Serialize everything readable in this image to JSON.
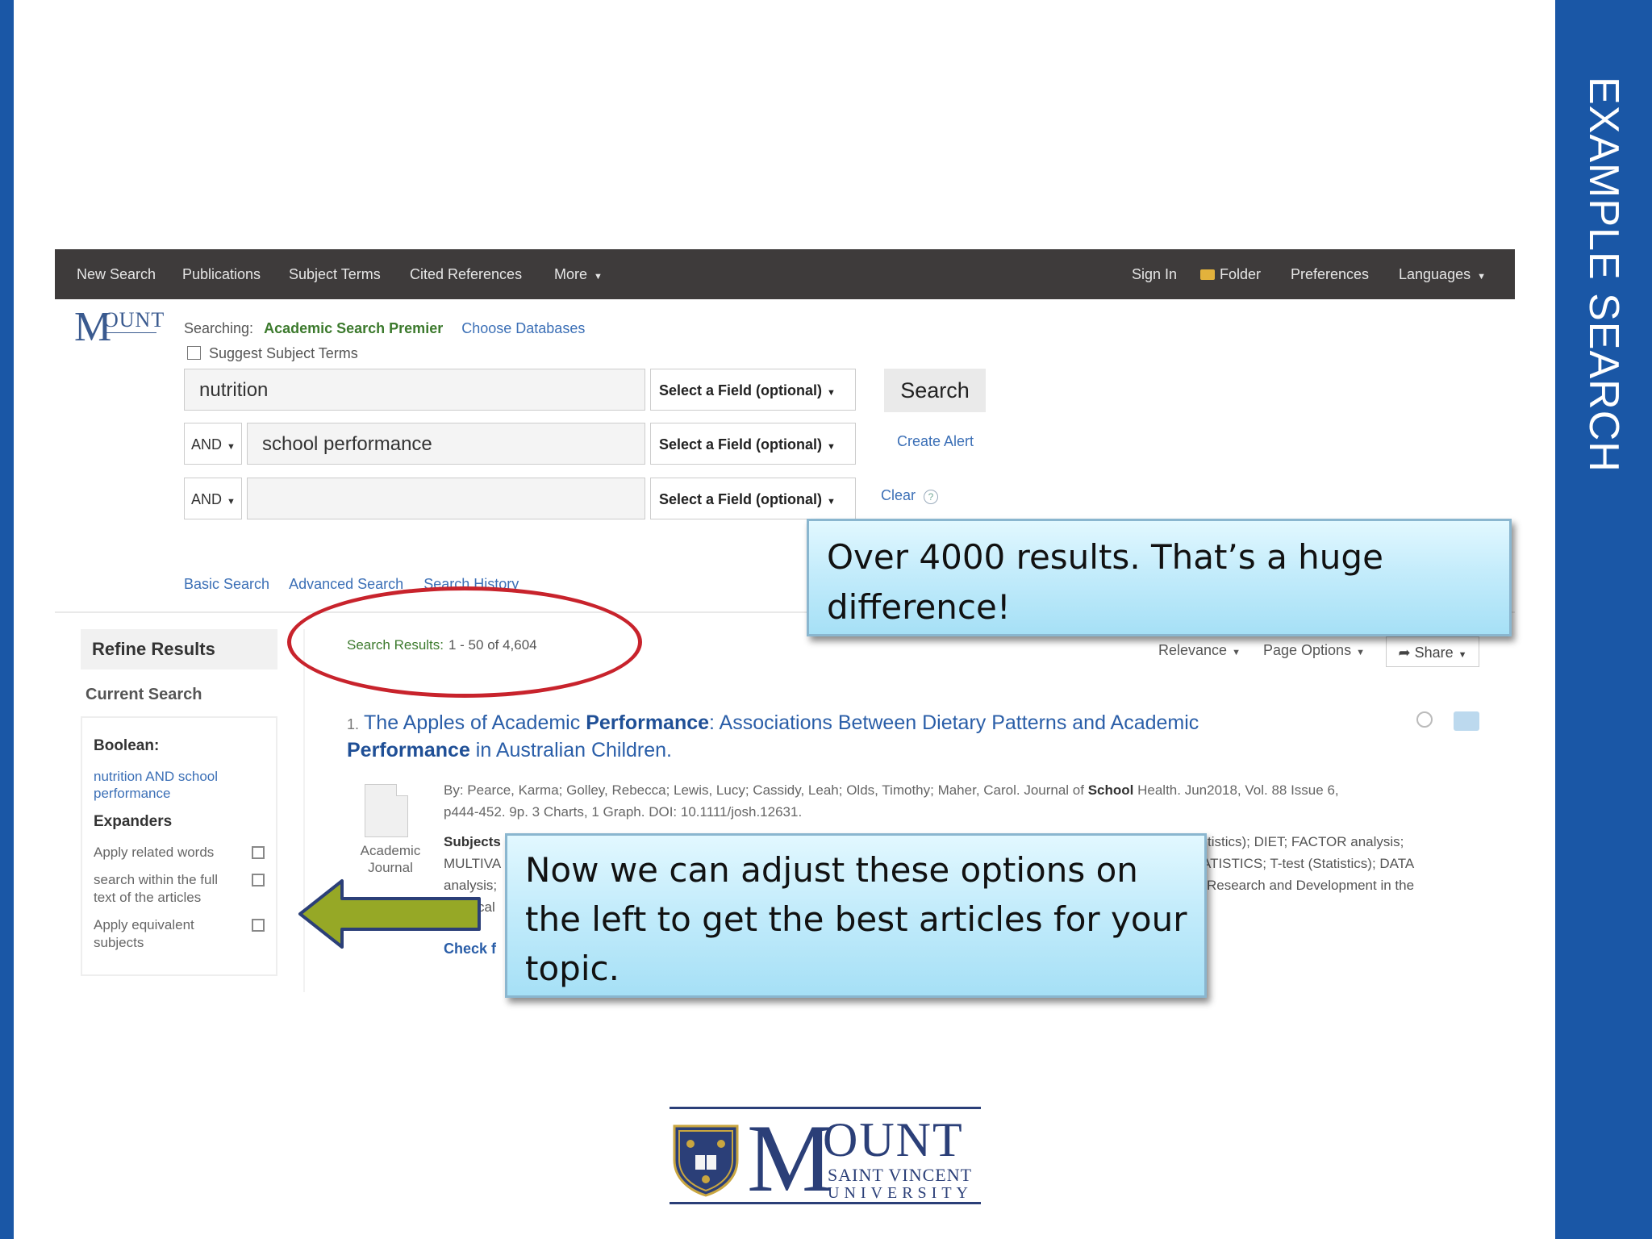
{
  "slide": {
    "title": "EXAMPLE SEARCH"
  },
  "colors": {
    "brand_blue": "#1a57a6",
    "nav_bg": "#3e3b3b",
    "link_blue": "#3b6fb6",
    "green": "#3c7a2d",
    "red_circle": "#c8232c",
    "arrow_green": "#96a826"
  },
  "topnav": {
    "left": [
      "New Search",
      "Publications",
      "Subject Terms",
      "Cited References",
      "More"
    ],
    "right": [
      "Sign In",
      "Folder",
      "Preferences",
      "Languages"
    ]
  },
  "logo_small": {
    "m": "M",
    "ount": "OUNT"
  },
  "search": {
    "searching_label": "Searching:",
    "database": "Academic Search Premier",
    "choose_databases": "Choose Databases",
    "suggest_label": "Suggest Subject Terms",
    "rows": [
      {
        "bool": "",
        "value": "nutrition",
        "field": "Select a Field (optional)"
      },
      {
        "bool": "AND",
        "value": "school performance",
        "field": "Select a Field (optional)"
      },
      {
        "bool": "AND",
        "value": "",
        "field": "Select a Field (optional)"
      }
    ],
    "search_button": "Search",
    "create_alert": "Create Alert",
    "clear": "Clear",
    "help_glyph": "?",
    "links": [
      "Basic Search",
      "Advanced Search",
      "Search History"
    ]
  },
  "refine": {
    "tab_label": "Refine Results",
    "current_search": "Current Search",
    "boolean_label": "Boolean:",
    "boolean_value_line1": "nutrition AND school",
    "boolean_value_line2": "performance",
    "expanders_label": "Expanders",
    "expander1": "Apply related words",
    "expander2_line1": "search within the full",
    "expander2_line2": "text of the articles",
    "expander3_line1": "Apply equivalent",
    "expander3_line2": "subjects"
  },
  "results": {
    "label": "Search Results:",
    "range": "1 - 50 of 4,604",
    "sort": [
      "Relevance",
      "Page Options"
    ],
    "share": "Share",
    "item": {
      "number": "1.",
      "title_a": "The Apples of Academic ",
      "title_b": "Performance",
      "title_c": ": Associations Between Dietary Patterns and Academic",
      "title_d": "Performance",
      "title_e": " in Australian Children.",
      "type_line1": "Academic",
      "type_line2": "Journal",
      "byline_a": "By: Pearce, Karma; Golley, Rebecca; Lewis, Lucy; Cassidy, Leah; Olds, Timothy; Maher, Carol. Journal of ",
      "byline_b": "School",
      "byline_c": " Health. Jun2018, Vol. 88 Issue 6,",
      "byline_d": "p444-452. 9p. 3 Charts, 1 Graph. DOI: 10.1111/josh.12631.",
      "subjects_frag": "Subjects",
      "frag_multiva": "MULTIVA",
      "frag_analysis": "analysis;",
      "frag_cal": "cal",
      "frag_r1": "tistics); DIET; FACTOR analysis;",
      "frag_r2": "ATISTICS; T-test (Statistics); DATA",
      "frag_r3": "Research and Development in the",
      "check_frag": "Check f"
    }
  },
  "callouts": {
    "top": "Over 4000 results. That’s a huge difference!",
    "bottom": "Now we can adjust these options on the left to get the best articles for your topic."
  },
  "logo_big": {
    "m": "M",
    "ount": "OUNT",
    "line2": "SAINT VINCENT",
    "line3": "UNIVERSITY"
  }
}
